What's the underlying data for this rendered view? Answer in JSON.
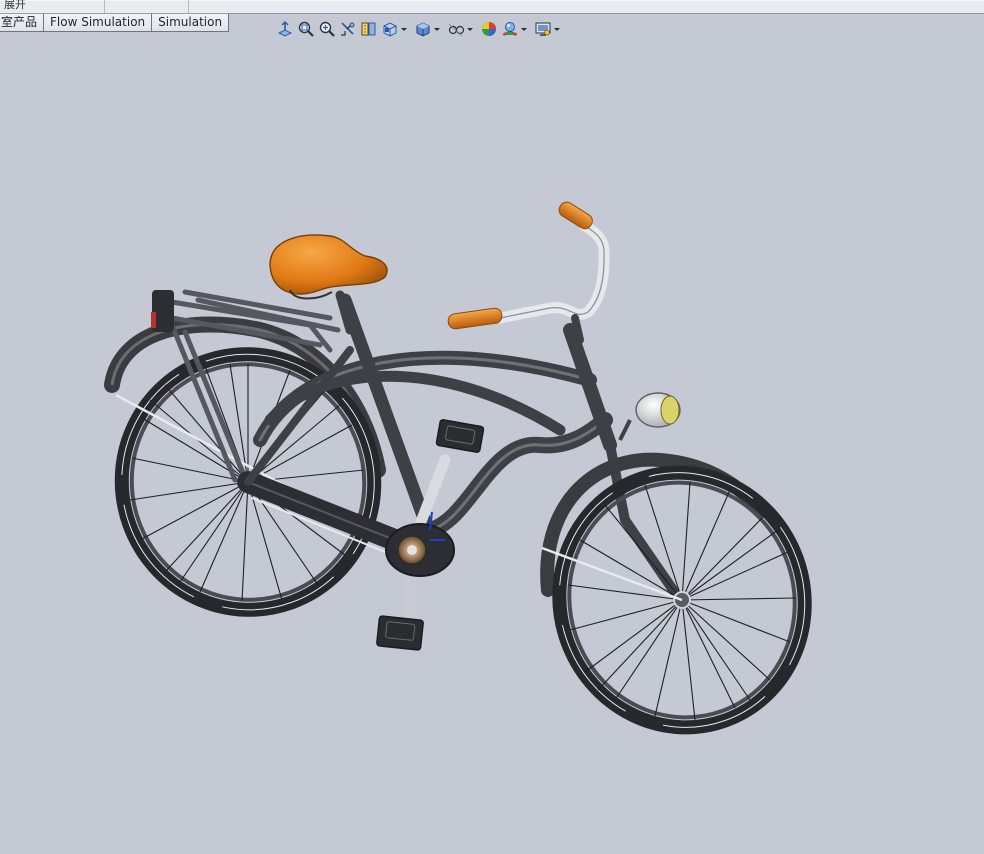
{
  "top_strip": {
    "label": "展开"
  },
  "tabs": [
    {
      "label": "室产品"
    },
    {
      "label": "Flow Simulation"
    },
    {
      "label": "Simulation"
    }
  ],
  "view_toolbar": {
    "buttons": [
      {
        "icon": "zoom-to-fit-icon",
        "has_dropdown": false
      },
      {
        "icon": "zoom-to-area-icon",
        "has_dropdown": false
      },
      {
        "icon": "previous-view-icon",
        "has_dropdown": false
      },
      {
        "icon": "section-view-icon",
        "has_dropdown": false
      },
      {
        "icon": "dynamic-annotation-views-icon",
        "has_dropdown": false
      },
      {
        "icon": "view-orientation-icon",
        "has_dropdown": true
      },
      {
        "icon": "display-style-icon",
        "has_dropdown": true
      },
      {
        "icon": "hide-show-items-icon",
        "has_dropdown": true
      },
      {
        "icon": "edit-appearance-icon",
        "has_dropdown": false
      },
      {
        "icon": "apply-scene-icon",
        "has_dropdown": true
      },
      {
        "icon": "view-settings-icon",
        "has_dropdown": true
      }
    ]
  },
  "viewport": {
    "background": "#c4c9d4",
    "model": "bicycle",
    "colors": {
      "frame": "#4a4d52",
      "saddle": "#e07a14",
      "grips": "#e07a14",
      "tire": "#2a2c30",
      "chrome": "#dfe2e6",
      "headlight_lens": "#d9d46a",
      "hub": "#9a7a5a"
    }
  }
}
